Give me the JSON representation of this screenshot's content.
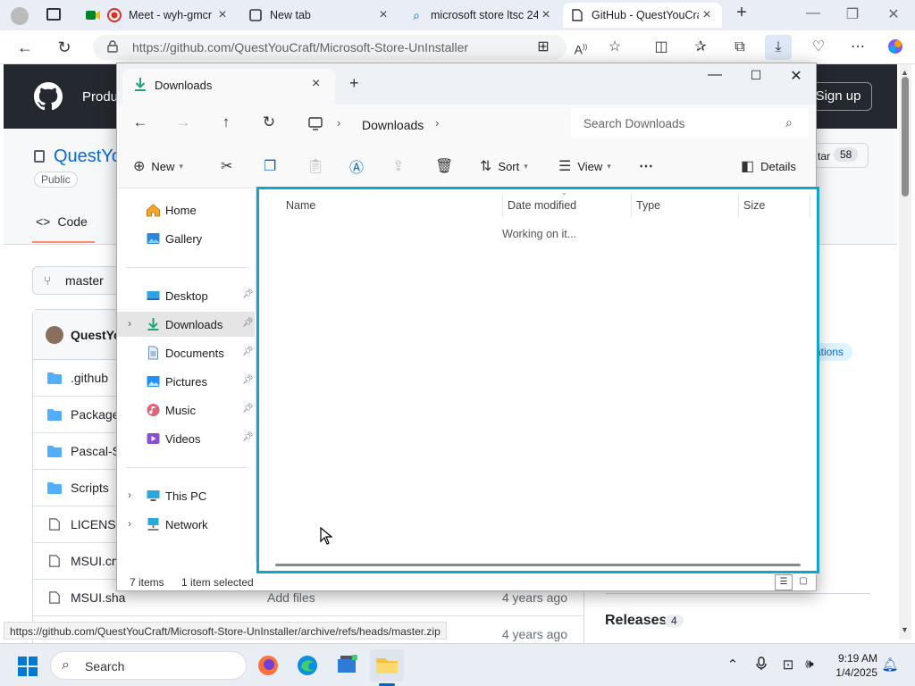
{
  "browser": {
    "tabs": [
      {
        "title": "Meet - wyh-gmcr",
        "active": false
      },
      {
        "title": "New tab",
        "active": false
      },
      {
        "title": "microsoft store ltsc 24",
        "active": false
      },
      {
        "title": "GitHub - QuestYouCraft",
        "active": true
      }
    ],
    "url": "https://github.com/QuestYouCraft/Microsoft-Store-UnInstaller",
    "status_url": "https://github.com/QuestYouCraft/Microsoft-Store-UnInstaller/archive/refs/heads/master.zip"
  },
  "github": {
    "product_label": "Produ",
    "signup_label": "Sign up",
    "repo_name": "QuestYo",
    "visibility": "Public",
    "code_tab": "Code",
    "star_label": "tar",
    "star_count": "58",
    "branch": "master",
    "owner": "QuestYo",
    "topic": "cations",
    "releases_label": "Releases",
    "releases_count": "4",
    "files": [
      {
        "name": ".github",
        "type": "folder",
        "message": "",
        "age": ""
      },
      {
        "name": "Package",
        "type": "folder",
        "message": "",
        "age": ""
      },
      {
        "name": "Pascal-S",
        "type": "folder",
        "message": "",
        "age": ""
      },
      {
        "name": "Scripts",
        "type": "folder",
        "message": "",
        "age": ""
      },
      {
        "name": "LICENSE",
        "type": "file",
        "message": "",
        "age": ""
      },
      {
        "name": "MSUI.cm",
        "type": "file",
        "message": "",
        "age": ""
      },
      {
        "name": "MSUI.sha",
        "type": "file",
        "message": "Add files",
        "age": "4 years ago"
      },
      {
        "name": "",
        "type": "file",
        "message": "",
        "age": "4 years ago"
      }
    ]
  },
  "explorer": {
    "tab_title": "Downloads",
    "breadcrumb": "Downloads",
    "search_placeholder": "Search Downloads",
    "toolbar": {
      "new_label": "New",
      "sort_label": "Sort",
      "view_label": "View",
      "details_label": "Details"
    },
    "sidebar": {
      "top": [
        {
          "label": "Home",
          "icon": "home-icon"
        },
        {
          "label": "Gallery",
          "icon": "gallery-icon"
        }
      ],
      "pinned": [
        {
          "label": "Desktop",
          "icon": "desktop-icon",
          "selected": false
        },
        {
          "label": "Downloads",
          "icon": "downloads-icon",
          "selected": true
        },
        {
          "label": "Documents",
          "icon": "documents-icon",
          "selected": false
        },
        {
          "label": "Pictures",
          "icon": "pictures-icon",
          "selected": false
        },
        {
          "label": "Music",
          "icon": "music-icon",
          "selected": false
        },
        {
          "label": "Videos",
          "icon": "videos-icon",
          "selected": false
        }
      ],
      "bottom": [
        {
          "label": "This PC",
          "icon": "pc-icon"
        },
        {
          "label": "Network",
          "icon": "network-icon"
        }
      ]
    },
    "columns": [
      "Name",
      "Date modified",
      "Type",
      "Size"
    ],
    "loading_text": "Working on it...",
    "status": {
      "items": "7 items",
      "selected": "1 item selected"
    }
  },
  "taskbar": {
    "search_label": "Search",
    "time": "9:19 AM",
    "date": "1/4/2025"
  },
  "colors": {
    "highlight": "#11a4cc",
    "github_header": "#24292f",
    "link": "#0969da",
    "folder": "#54aeff"
  }
}
